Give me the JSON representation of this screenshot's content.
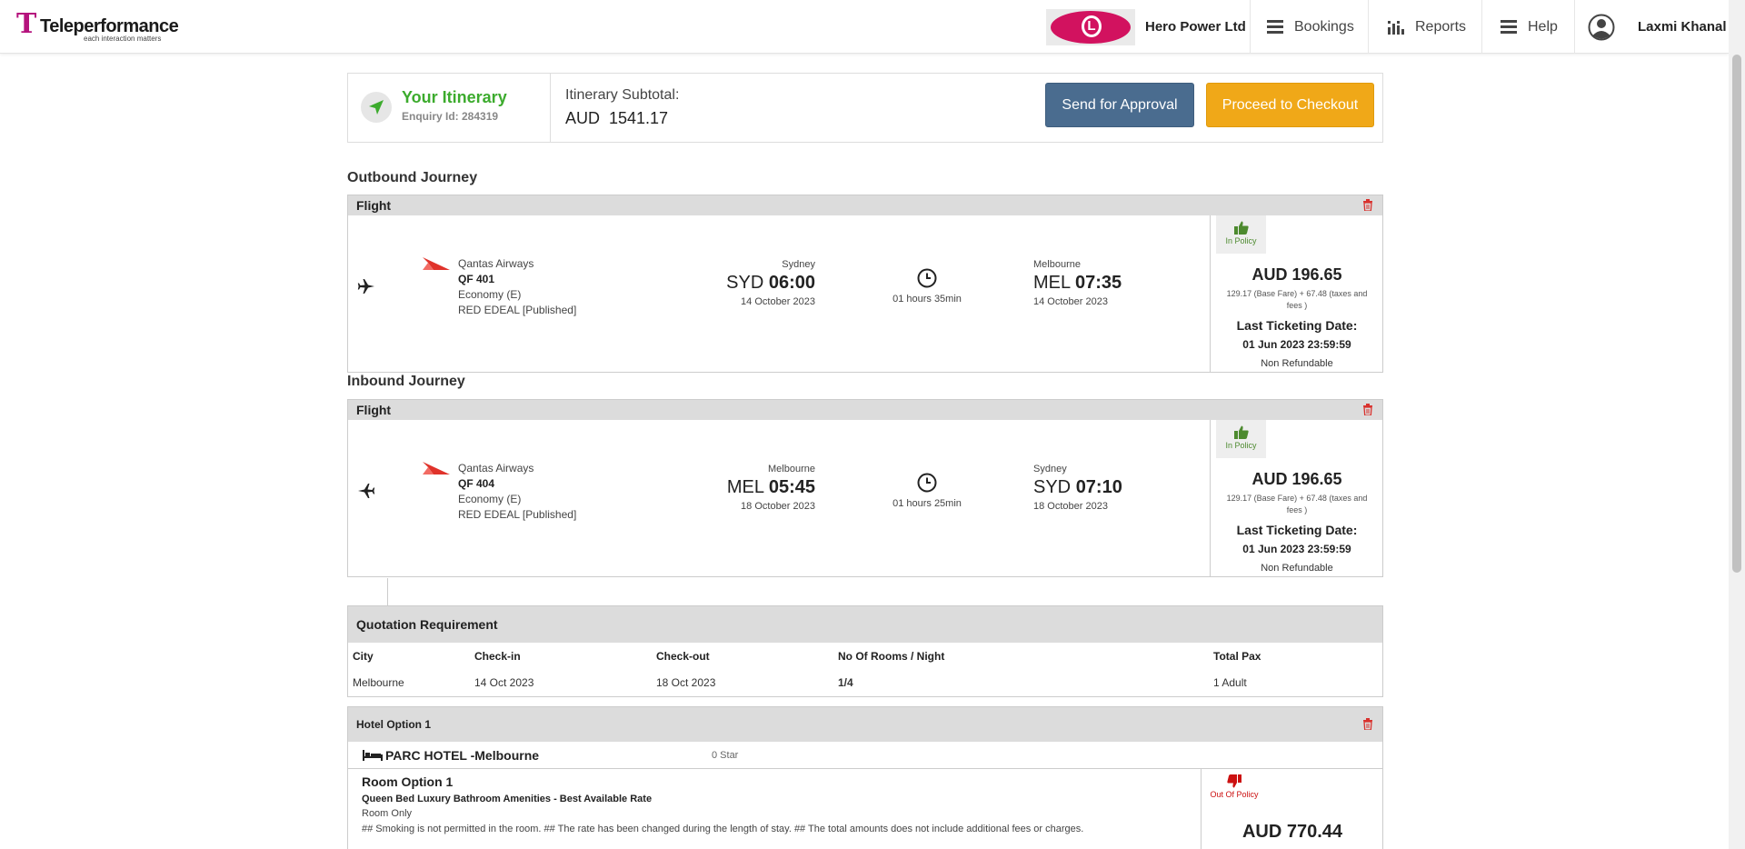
{
  "header": {
    "logo_name": "Teleperformance",
    "logo_tagline": "each interaction matters",
    "company": "Hero Power Ltd",
    "brand_logo_text": "L",
    "nav": {
      "bookings": "Bookings",
      "reports": "Reports",
      "help": "Help"
    },
    "user_name": "Laxmi Khanal"
  },
  "itinerary": {
    "title": "Your Itinerary",
    "enquiry": "Enquiry Id: 284319",
    "subtotal_label": "Itinerary Subtotal:",
    "subtotal_value": "AUD  1541.17",
    "send_for_approval": "Send for Approval",
    "proceed_to_checkout": "Proceed to Checkout"
  },
  "outbound": {
    "section_title": "Outbound Journey",
    "card_label": "Flight",
    "airline": "Qantas Airways",
    "flight_no": "QF 401",
    "cabin": "Economy (E)",
    "fare_type": "RED EDEAL [Published]",
    "dep_city": "Sydney",
    "dep_code": "SYD",
    "dep_time": "06:00",
    "dep_date": "14 October 2023",
    "duration": "01 hours 35min",
    "arr_city": "Melbourne",
    "arr_code": "MEL",
    "arr_time": "07:35",
    "arr_date": "14 October 2023",
    "policy": "In Policy",
    "price": "AUD 196.65",
    "fare_breakdown": "129.17 (Base Fare) + 67.48 (taxes and fees )",
    "ltd_label": "Last Ticketing Date:",
    "ltd_value": "01 Jun 2023 23:59:59",
    "refund": "Non Refundable"
  },
  "inbound": {
    "section_title": "Inbound Journey",
    "card_label": "Flight",
    "airline": "Qantas Airways",
    "flight_no": "QF 404",
    "cabin": "Economy (E)",
    "fare_type": "RED EDEAL [Published]",
    "dep_city": "Melbourne",
    "dep_code": "MEL",
    "dep_time": "05:45",
    "dep_date": "18 October 2023",
    "duration": "01 hours 25min",
    "arr_city": "Sydney",
    "arr_code": "SYD",
    "arr_time": "07:10",
    "arr_date": "18 October 2023",
    "policy": "In Policy",
    "price": "AUD 196.65",
    "fare_breakdown": "129.17 (Base Fare) + 67.48 (taxes and fees )",
    "ltd_label": "Last Ticketing Date:",
    "ltd_value": "01 Jun 2023 23:59:59",
    "refund": "Non Refundable"
  },
  "quotation": {
    "title": "Quotation Requirement",
    "headers": [
      "City",
      "Check-in",
      "Check-out",
      "No Of Rooms / Night",
      "Total Pax"
    ],
    "values": [
      "Melbourne",
      "14 Oct 2023",
      "18 Oct 2023",
      "1/4",
      "1 Adult"
    ]
  },
  "hotel": {
    "option_label": "Hotel Option 1",
    "name": "PARC HOTEL -Melbourne",
    "star": "0 Star",
    "room_title": "Room Option 1",
    "room_type": "Queen Bed Luxury Bathroom Amenities - Best Available Rate",
    "board": "Room Only",
    "notes": "## Smoking is not permitted in the room. ## The rate has been changed during the length of stay. ## The total amounts does not include additional fees or charges.",
    "policy": "Out Of Policy",
    "price": "AUD 770.44"
  },
  "colors": {
    "brand": "#b5137d",
    "in_policy": "#4d8a2f",
    "out_policy": "#cc1111",
    "approval_button": "#4a6c8f",
    "checkout_button": "#f0a818"
  },
  "icons": [
    "trash-icon",
    "plane-icon",
    "clock-icon",
    "thumbs-up-icon",
    "thumbs-down-icon",
    "bed-icon",
    "menu-icon",
    "bar-chart-icon",
    "user-icon",
    "navigation-arrow-icon"
  ]
}
